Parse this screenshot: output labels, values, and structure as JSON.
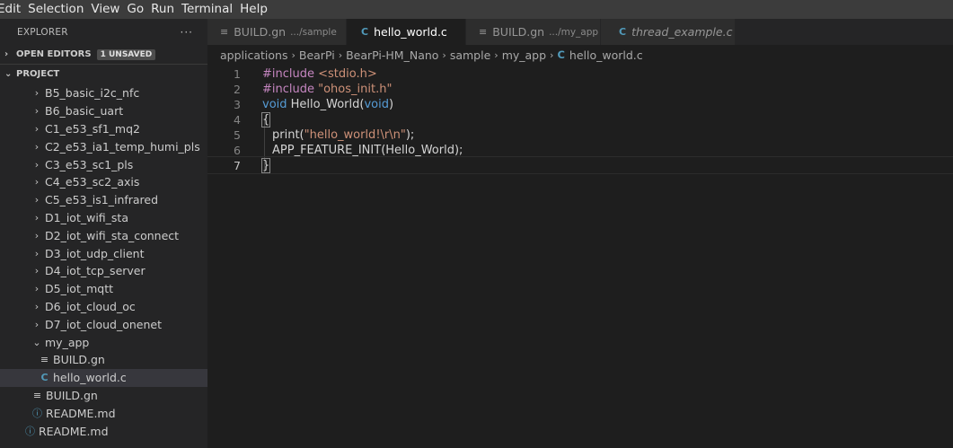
{
  "menu": [
    "Edit",
    "Selection",
    "View",
    "Go",
    "Run",
    "Terminal",
    "Help"
  ],
  "sidebar": {
    "title": "EXPLORER",
    "more": "···",
    "open_editors": {
      "label": "OPEN EDITORS",
      "badge": "1 UNSAVED"
    },
    "project": {
      "label": "PROJECT"
    },
    "items": [
      {
        "label": "B5_basic_i2c_nfc",
        "type": "folder",
        "expanded": false
      },
      {
        "label": "B6_basic_uart",
        "type": "folder",
        "expanded": false
      },
      {
        "label": "C1_e53_sf1_mq2",
        "type": "folder",
        "expanded": false
      },
      {
        "label": "C2_e53_ia1_temp_humi_pls",
        "type": "folder",
        "expanded": false
      },
      {
        "label": "C3_e53_sc1_pls",
        "type": "folder",
        "expanded": false
      },
      {
        "label": "C4_e53_sc2_axis",
        "type": "folder",
        "expanded": false
      },
      {
        "label": "C5_e53_is1_infrared",
        "type": "folder",
        "expanded": false
      },
      {
        "label": "D1_iot_wifi_sta",
        "type": "folder",
        "expanded": false
      },
      {
        "label": "D2_iot_wifi_sta_connect",
        "type": "folder",
        "expanded": false
      },
      {
        "label": "D3_iot_udp_client",
        "type": "folder",
        "expanded": false
      },
      {
        "label": "D4_iot_tcp_server",
        "type": "folder",
        "expanded": false
      },
      {
        "label": "D5_iot_mqtt",
        "type": "folder",
        "expanded": false
      },
      {
        "label": "D6_iot_cloud_oc",
        "type": "folder",
        "expanded": false
      },
      {
        "label": "D7_iot_cloud_onenet",
        "type": "folder",
        "expanded": false
      },
      {
        "label": "my_app",
        "type": "folder",
        "expanded": true
      },
      {
        "label": "BUILD.gn",
        "type": "build"
      },
      {
        "label": "hello_world.c",
        "type": "c"
      },
      {
        "label": "BUILD.gn",
        "type": "build"
      },
      {
        "label": "README.md",
        "type": "info"
      },
      {
        "label": "README.md",
        "type": "info"
      }
    ]
  },
  "tabs": [
    {
      "icon": "≡",
      "label": "BUILD.gn",
      "desc": ".../sample",
      "active": false
    },
    {
      "icon": "C",
      "label": "hello_world.c",
      "desc": "",
      "active": true,
      "dirty": true
    },
    {
      "icon": "≡",
      "label": "BUILD.gn",
      "desc": ".../my_app",
      "active": false
    },
    {
      "icon": "C",
      "label": "thread_example.c",
      "desc": "",
      "active": false,
      "italic": true
    }
  ],
  "breadcrumb": [
    "applications",
    "BearPi",
    "BearPi-HM_Nano",
    "sample",
    "my_app",
    "hello_world.c"
  ],
  "editor": {
    "line_numbers": [
      "1",
      "2",
      "3",
      "4",
      "5",
      "6",
      "7"
    ],
    "lines": [
      {
        "a": "#include ",
        "b": "<stdio.h>"
      },
      {
        "a": "#include ",
        "b": "\"ohos_init.h\""
      },
      {
        "a": "void ",
        "b": "Hello_World",
        "c": "(",
        "d": "void",
        "e": ")"
      },
      {
        "a": "{"
      },
      {
        "a": "print",
        "b": "(",
        "c": "\"hello_world!\\r\\n\"",
        "d": ");"
      },
      {
        "a": "APP_FEATURE_INIT",
        "b": "(Hello_World);"
      },
      {
        "a": "}"
      }
    ]
  },
  "colors": {
    "accent": "#519aba",
    "background": "#1e1e1e",
    "sidebar": "#252526"
  }
}
